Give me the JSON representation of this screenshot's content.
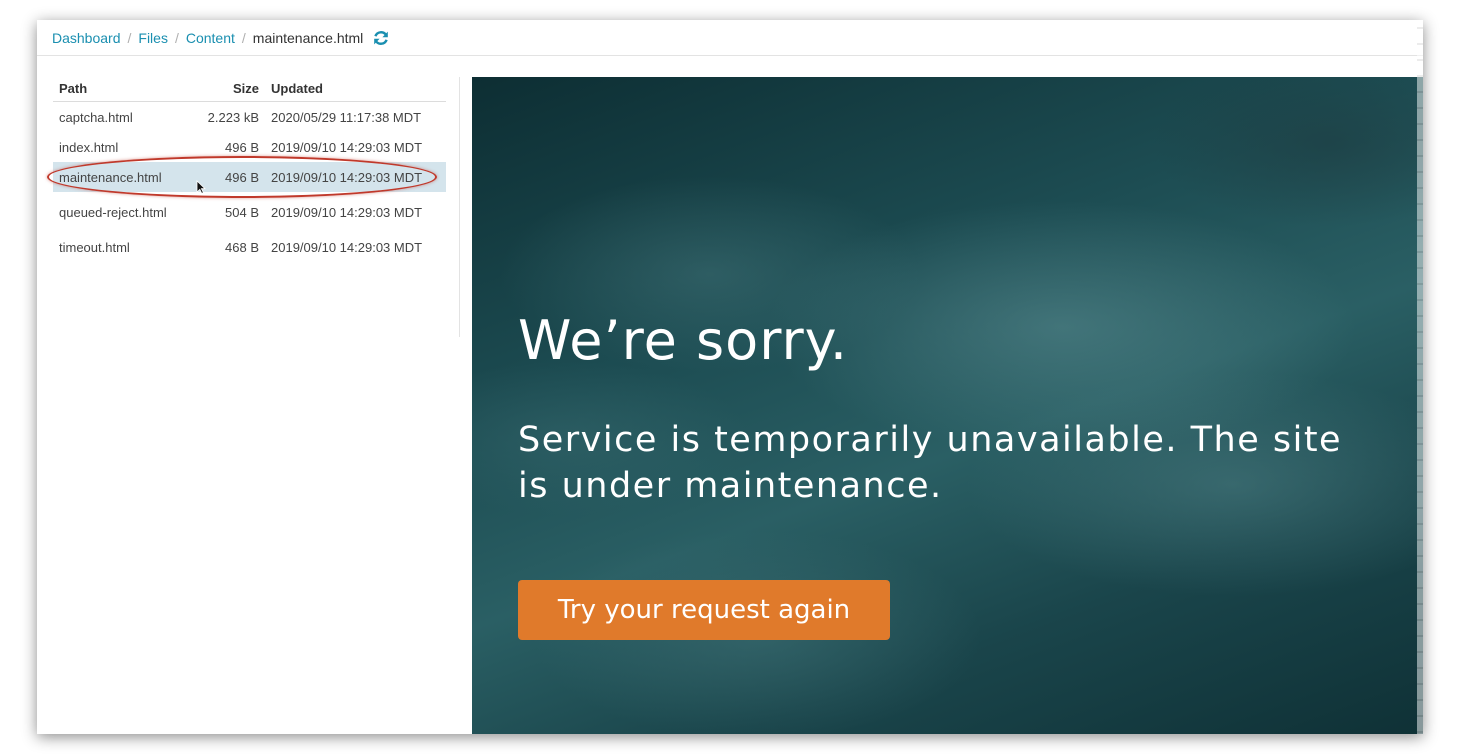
{
  "breadcrumb": {
    "items": [
      "Dashboard",
      "Files",
      "Content"
    ],
    "separator": "/",
    "current": "maintenance.html"
  },
  "icons": {
    "refresh": "refresh-icon",
    "cursor": "mouse-pointer-icon"
  },
  "files": {
    "columns": {
      "path": "Path",
      "size": "Size",
      "updated": "Updated"
    },
    "rows": [
      {
        "path": "captcha.html",
        "size": "2.223 kB",
        "updated": "2020/05/29 11:17:38 MDT"
      },
      {
        "path": "index.html",
        "size": "496 B",
        "updated": "2019/09/10 14:29:03 MDT"
      },
      {
        "path": "maintenance.html",
        "size": "496 B",
        "updated": "2019/09/10 14:29:03 MDT"
      },
      {
        "path": "queued-reject.html",
        "size": "504 B",
        "updated": "2019/09/10 14:29:03 MDT"
      },
      {
        "path": "timeout.html",
        "size": "468 B",
        "updated": "2019/09/10 14:29:03 MDT"
      }
    ],
    "selected_index": 2
  },
  "preview": {
    "heading": "We’re sorry.",
    "message": "Service is temporarily unavailable. The site is under maintenance.",
    "button_label": "Try your request again"
  },
  "colors": {
    "link": "#1a8fb0",
    "selected_row": "#d4e4ec",
    "highlight_ring": "#c0392b",
    "button": "#e07a2b",
    "preview_background": "#1d4d53"
  }
}
